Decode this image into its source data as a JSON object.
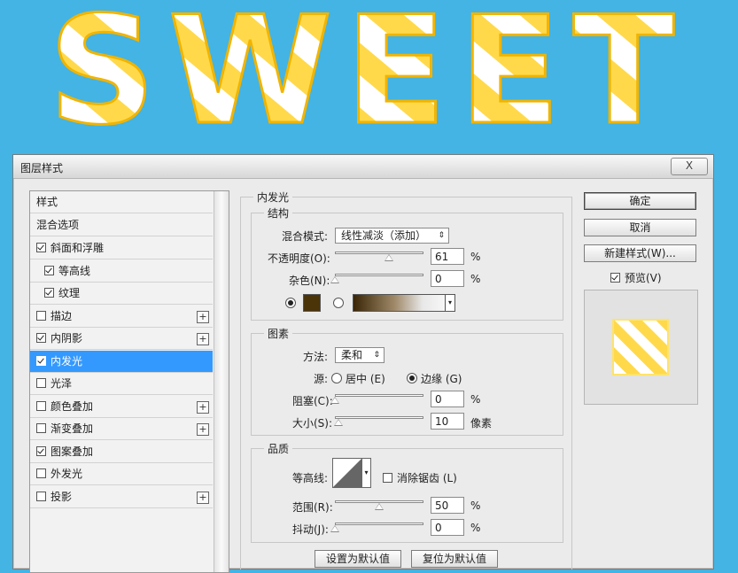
{
  "banner": {
    "text": "SWEET"
  },
  "dialog": {
    "title": "图层样式",
    "close_label": "X",
    "styles_header": "样式",
    "blending_options": "混合选项",
    "items": [
      {
        "label": "斜面和浮雕",
        "checked": true,
        "sub": false,
        "plus": false
      },
      {
        "label": "等高线",
        "checked": true,
        "sub": true,
        "plus": false
      },
      {
        "label": "纹理",
        "checked": true,
        "sub": true,
        "plus": false
      },
      {
        "label": "描边",
        "checked": false,
        "sub": false,
        "plus": true
      },
      {
        "label": "内阴影",
        "checked": true,
        "sub": false,
        "plus": true
      },
      {
        "label": "内发光",
        "checked": true,
        "sub": false,
        "plus": false,
        "active": true
      },
      {
        "label": "光泽",
        "checked": false,
        "sub": false,
        "plus": false
      },
      {
        "label": "颜色叠加",
        "checked": false,
        "sub": false,
        "plus": true
      },
      {
        "label": "渐变叠加",
        "checked": false,
        "sub": false,
        "plus": true
      },
      {
        "label": "图案叠加",
        "checked": true,
        "sub": false,
        "plus": false
      },
      {
        "label": "外发光",
        "checked": false,
        "sub": false,
        "plus": false
      },
      {
        "label": "投影",
        "checked": false,
        "sub": false,
        "plus": true
      }
    ],
    "plus_label": "+"
  },
  "inner_glow": {
    "title": "内发光",
    "structure": {
      "legend": "结构",
      "blend_mode_label": "混合模式:",
      "blend_mode_value": "线性减淡（添加）",
      "opacity_label": "不透明度(O):",
      "opacity_value": "61",
      "noise_label": "杂色(N):",
      "noise_value": "0",
      "percent": "%",
      "color_swatch": "#4a3408"
    },
    "elements": {
      "legend": "图素",
      "technique_label": "方法:",
      "technique_value": "柔和",
      "source_label": "源:",
      "source_center": "居中 (E)",
      "source_edge": "边缘 (G)",
      "choke_label": "阻塞(C):",
      "choke_value": "0",
      "size_label": "大小(S):",
      "size_value": "10",
      "size_unit": "像素",
      "percent": "%"
    },
    "quality": {
      "legend": "品质",
      "contour_label": "等高线:",
      "antialias_label": "消除锯齿 (L)",
      "range_label": "范围(R):",
      "range_value": "50",
      "jitter_label": "抖动(J):",
      "jitter_value": "0",
      "percent": "%"
    },
    "make_default": "设置为默认值",
    "reset_default": "复位为默认值"
  },
  "side": {
    "ok": "确定",
    "cancel": "取消",
    "new_style": "新建样式(W)...",
    "preview_label": "预览(V)"
  }
}
